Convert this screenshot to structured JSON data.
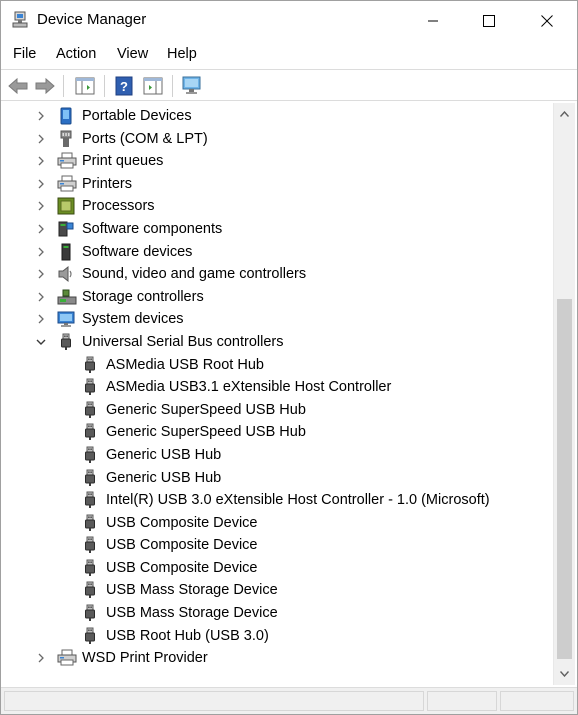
{
  "window": {
    "title": "Device Manager"
  },
  "menu": [
    "File",
    "Action",
    "View",
    "Help"
  ],
  "toolbar": {
    "buttons": [
      "back-arrow-icon",
      "forward-arrow-icon",
      "show-hide-console-tree-icon",
      "help-icon",
      "properties-pane-icon",
      "scan-hardware-changes-monitor-icon"
    ]
  },
  "tree": {
    "items": [
      {
        "label": "Portable Devices",
        "icon": "portable-device-icon",
        "level": 0,
        "expander": "collapsed"
      },
      {
        "label": "Ports (COM & LPT)",
        "icon": "port-icon",
        "level": 0,
        "expander": "collapsed"
      },
      {
        "label": "Print queues",
        "icon": "printer-icon",
        "level": 0,
        "expander": "collapsed"
      },
      {
        "label": "Printers",
        "icon": "printer-icon",
        "level": 0,
        "expander": "collapsed"
      },
      {
        "label": "Processors",
        "icon": "processor-icon",
        "level": 0,
        "expander": "collapsed"
      },
      {
        "label": "Software components",
        "icon": "software-component-icon",
        "level": 0,
        "expander": "collapsed"
      },
      {
        "label": "Software devices",
        "icon": "software-device-icon",
        "level": 0,
        "expander": "collapsed"
      },
      {
        "label": "Sound, video and game controllers",
        "icon": "speaker-icon",
        "level": 0,
        "expander": "collapsed"
      },
      {
        "label": "Storage controllers",
        "icon": "storage-controller-icon",
        "level": 0,
        "expander": "collapsed"
      },
      {
        "label": "System devices",
        "icon": "system-device-icon",
        "level": 0,
        "expander": "collapsed"
      },
      {
        "label": "Universal Serial Bus controllers",
        "icon": "usb-icon",
        "level": 0,
        "expander": "expanded"
      },
      {
        "label": "ASMedia USB Root Hub",
        "icon": "usb-icon",
        "level": 1
      },
      {
        "label": "ASMedia USB3.1 eXtensible Host Controller",
        "icon": "usb-icon",
        "level": 1
      },
      {
        "label": "Generic SuperSpeed USB Hub",
        "icon": "usb-icon",
        "level": 1
      },
      {
        "label": "Generic SuperSpeed USB Hub",
        "icon": "usb-icon",
        "level": 1
      },
      {
        "label": "Generic USB Hub",
        "icon": "usb-icon",
        "level": 1
      },
      {
        "label": "Generic USB Hub",
        "icon": "usb-icon",
        "level": 1
      },
      {
        "label": "Intel(R) USB 3.0 eXtensible Host Controller - 1.0 (Microsoft)",
        "icon": "usb-icon",
        "level": 1
      },
      {
        "label": "USB Composite Device",
        "icon": "usb-icon",
        "level": 1
      },
      {
        "label": "USB Composite Device",
        "icon": "usb-icon",
        "level": 1
      },
      {
        "label": "USB Composite Device",
        "icon": "usb-icon",
        "level": 1
      },
      {
        "label": "USB Mass Storage Device",
        "icon": "usb-icon",
        "level": 1
      },
      {
        "label": "USB Mass Storage Device",
        "icon": "usb-icon",
        "level": 1
      },
      {
        "label": "USB Root Hub (USB 3.0)",
        "icon": "usb-icon",
        "level": 1
      },
      {
        "label": "WSD Print Provider",
        "icon": "printer-icon",
        "level": 0,
        "expander": "collapsed"
      }
    ]
  },
  "colors": {
    "accent": "#3a84d4",
    "usb_plug": "#5a5a5a",
    "window_border": "#a0a0a0"
  }
}
